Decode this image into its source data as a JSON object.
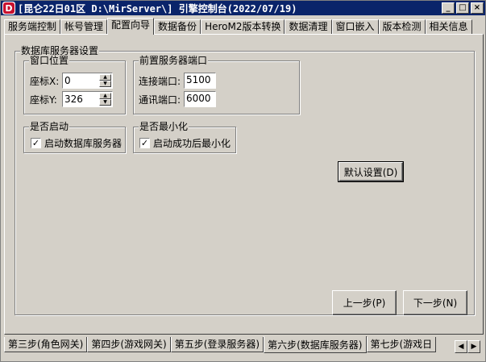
{
  "window": {
    "title": "[昆仑22日01区 D:\\MirServer\\] 引擎控制台(2022/07/19)",
    "icon_letter": "D",
    "controls": [
      "_",
      "□",
      "×"
    ]
  },
  "tabs": [
    {
      "label": "服务端控制",
      "active": false
    },
    {
      "label": "帐号管理",
      "active": false
    },
    {
      "label": "配置向导",
      "active": true
    },
    {
      "label": "数据备份",
      "active": false
    },
    {
      "label": "HeroM2版本转换",
      "active": false
    },
    {
      "label": "数据清理",
      "active": false
    },
    {
      "label": "窗口嵌入",
      "active": false
    },
    {
      "label": "版本检测",
      "active": false
    },
    {
      "label": "相关信息",
      "active": false
    }
  ],
  "db_settings": {
    "title": "数据库服务器设置",
    "window_position": {
      "title": "窗口位置",
      "x_label": "座标X:",
      "x_value": "0",
      "y_label": "座标Y:",
      "y_value": "326"
    },
    "front_port": {
      "title": "前置服务器端口",
      "connect_label": "连接端口:",
      "connect_value": "5100",
      "comm_label": "通讯端口:",
      "comm_value": "6000"
    },
    "autostart": {
      "title": "是否启动",
      "checkbox_label": "启动数据库服务器",
      "checked": true
    },
    "minimize": {
      "title": "是否最小化",
      "checkbox_label": "启动成功后最小化",
      "checked": true
    },
    "default_button": "默认设置(D)"
  },
  "nav": {
    "prev_button": "上一步(P)",
    "next_button": "下一步(N)"
  },
  "step_tabs": [
    {
      "label": "第三步(角色网关)",
      "active": false
    },
    {
      "label": "第四步(游戏网关)",
      "active": false
    },
    {
      "label": "第五步(登录服务器)",
      "active": false
    },
    {
      "label": "第六步(数据库服务器)",
      "active": true
    },
    {
      "label": "第七步(游戏日",
      "active": false
    }
  ],
  "step_scroll": {
    "left": "◀",
    "right": "▶"
  },
  "check_mark": "✓"
}
